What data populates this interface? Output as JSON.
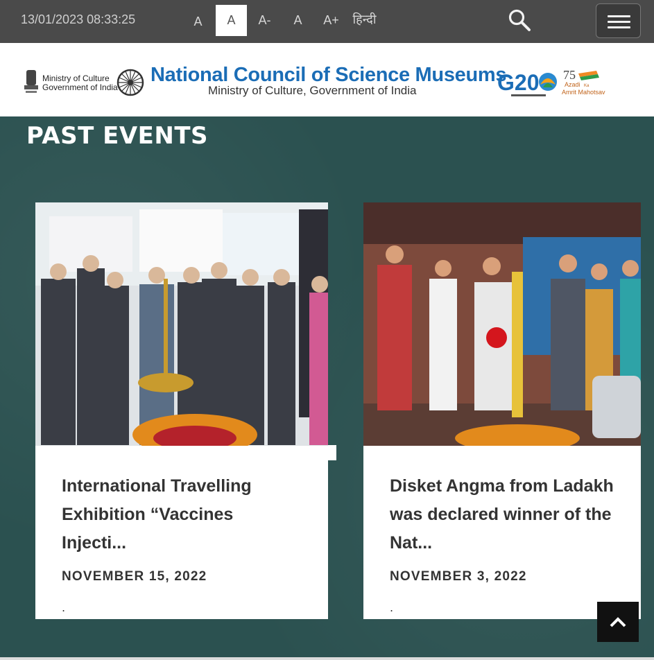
{
  "topbar": {
    "datetime": "13/01/2023 08:33:25",
    "font_buttons": [
      "A",
      "A",
      "A-",
      "A",
      "A+"
    ],
    "language": "हिन्दी",
    "search_icon": "search-icon",
    "menu_icon": "hamburger-icon"
  },
  "header": {
    "ministry_line1": "Ministry of Culture",
    "ministry_line2": "Government of India",
    "org_title": "National Council of Science Museums",
    "org_subtitle": "Ministry of Culture, Government of India",
    "g20_label": "G20",
    "azadi_line1": "Azadi",
    "azadi_line2": "Ka",
    "azadi_line3": "Amrit Mahotsav"
  },
  "section": {
    "title": "PAST EVENTS"
  },
  "events": [
    {
      "title": "International Travelling Exhibition “Vaccines Injecti...",
      "date": "NOVEMBER 15, 2022",
      "excerpt": "."
    },
    {
      "title": "Disket Angma from Ladakh was declared winner of the Nat...",
      "date": "NOVEMBER 3, 2022",
      "excerpt": "."
    }
  ],
  "colors": {
    "topbar": "#4a4a4a",
    "section_bg": "#2b5150",
    "brand_blue": "#1b6db6"
  }
}
